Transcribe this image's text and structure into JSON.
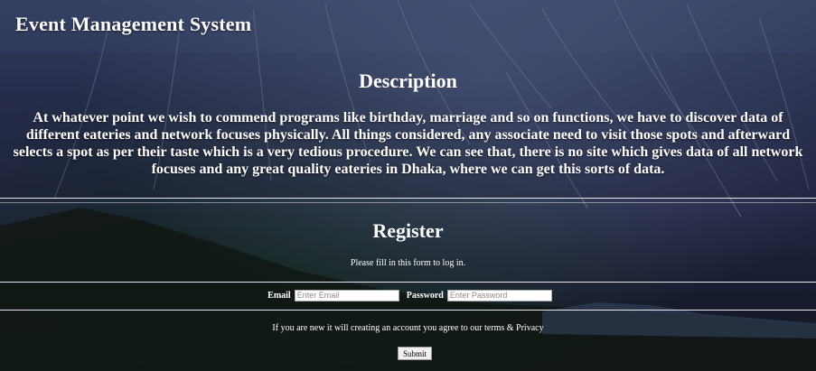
{
  "app": {
    "title": "Event Management System"
  },
  "description": {
    "heading": "Description",
    "lines": [
      "At whatever point we wish to commend programs like birthday, marriage and so on functions, we have to discover data of",
      "different eateries and network focuses physically. All things considered, any associate need to visit those spots and afterward",
      "selects a spot as per their taste which is a very tedious procedure. We can see that, there is no site which gives data of all network",
      "focuses and any great quality eateries in Dhaka, where we can get this sorts of data."
    ]
  },
  "register": {
    "heading": "Register",
    "subtitle": "Please fill in this form to log in.",
    "email_label": "Email",
    "email_placeholder": "Enter Email",
    "password_label": "Password",
    "password_placeholder": "Enter Password",
    "terms_text": "If you are new it will creating an account you agree to our terms & Privacy",
    "submit_label": "Submit"
  }
}
